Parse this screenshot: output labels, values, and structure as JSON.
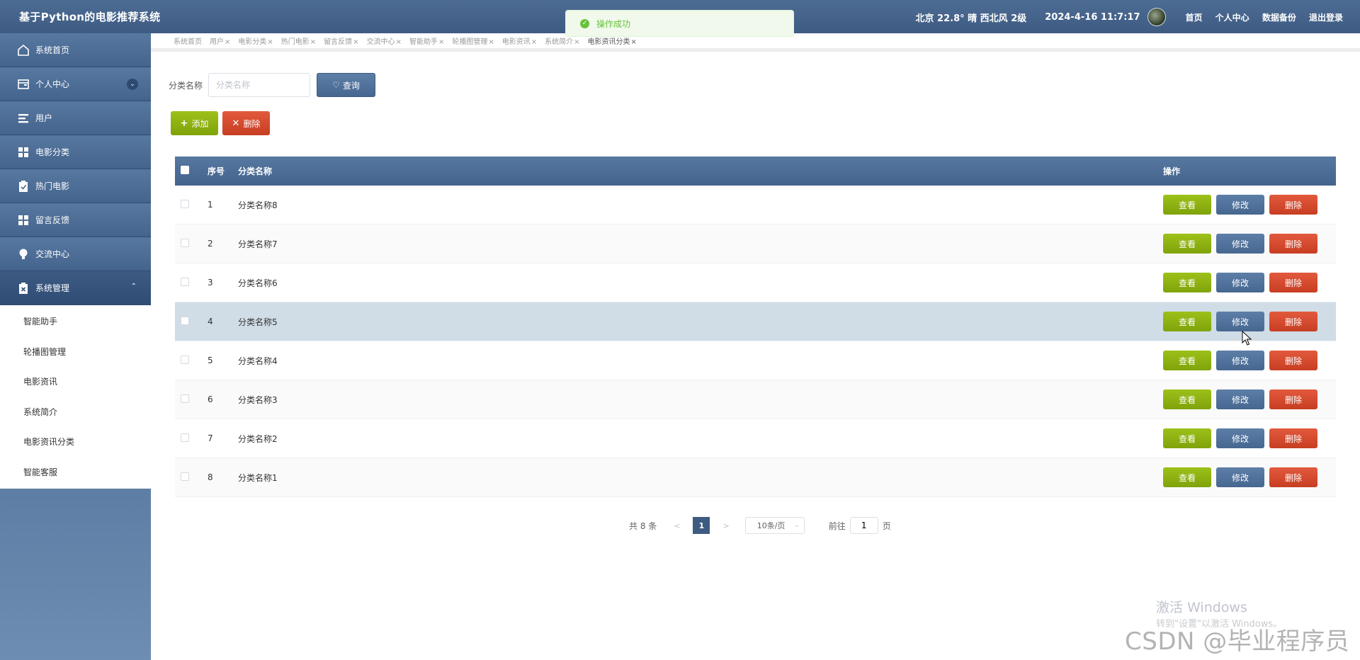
{
  "header": {
    "title": "基于Python的电影推荐系统",
    "weather": "北京  22.8°  晴  西北风  2级",
    "datetime": "2024-4-16 11:7:17",
    "nav": [
      "首页",
      "个人中心",
      "数据备份",
      "退出登录"
    ]
  },
  "toast": {
    "message": "操作成功"
  },
  "sidebar": {
    "items": [
      {
        "label": "系统首页",
        "icon": "home-icon"
      },
      {
        "label": "个人中心",
        "icon": "wallet-icon"
      },
      {
        "label": "用户",
        "icon": "list-icon"
      },
      {
        "label": "电影分类",
        "icon": "grid-icon"
      },
      {
        "label": "热门电影",
        "icon": "clipboard-check-icon"
      },
      {
        "label": "留言反馈",
        "icon": "grid-icon"
      },
      {
        "label": "交流中心",
        "icon": "bulb-icon"
      },
      {
        "label": "系统管理",
        "icon": "clipboard-x-icon"
      }
    ],
    "submenu": [
      "智能助手",
      "轮播图管理",
      "电影资讯",
      "系统简介",
      "电影资讯分类",
      "智能客服"
    ]
  },
  "tabs": [
    "系统首页",
    "用户",
    "电影分类",
    "热门电影",
    "留言反馈",
    "交流中心",
    "智能助手",
    "轮播图管理",
    "电影资讯",
    "系统简介",
    "电影资讯分类"
  ],
  "search": {
    "label": "分类名称",
    "placeholder": "分类名称",
    "button": "查询"
  },
  "actions": {
    "add": "添加",
    "delete": "删除"
  },
  "table": {
    "headers": {
      "index": "序号",
      "name": "分类名称",
      "ops": "操作"
    },
    "rows": [
      {
        "index": "1",
        "name": "分类名称8"
      },
      {
        "index": "2",
        "name": "分类名称7"
      },
      {
        "index": "3",
        "name": "分类名称6"
      },
      {
        "index": "4",
        "name": "分类名称5"
      },
      {
        "index": "5",
        "name": "分类名称4"
      },
      {
        "index": "6",
        "name": "分类名称3"
      },
      {
        "index": "7",
        "name": "分类名称2"
      },
      {
        "index": "8",
        "name": "分类名称1"
      }
    ],
    "ops": {
      "view": "查看",
      "edit": "修改",
      "delete": "删除"
    }
  },
  "pager": {
    "total": "共 8 条",
    "page": "1",
    "size": "10条/页",
    "goto": "前往",
    "goto_value": "1",
    "unit": "页"
  },
  "watermark": {
    "line1": "激活 Windows",
    "line2": "转到\"设置\"以激活 Windows。",
    "csdn": "CSDN @毕业程序员"
  }
}
